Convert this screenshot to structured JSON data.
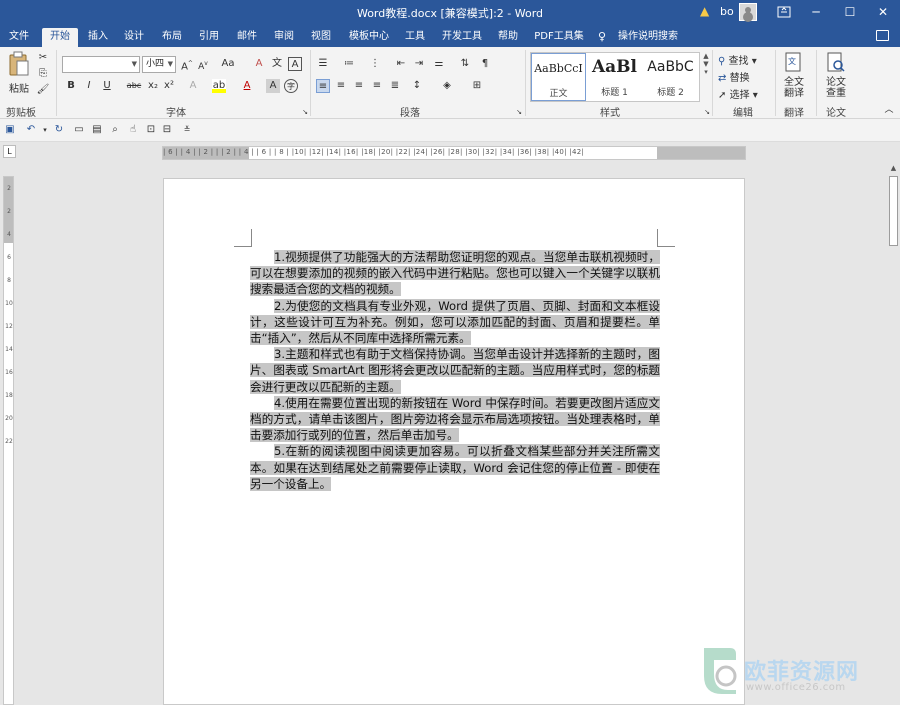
{
  "window": {
    "title": "Word教程.docx [兼容模式]:2  -  Word",
    "user": "bo",
    "minimize": "─",
    "restore": "☐",
    "close": "✕"
  },
  "tabs": [
    "文件",
    "开始",
    "插入",
    "设计",
    "布局",
    "引用",
    "邮件",
    "审阅",
    "视图",
    "模板中心",
    "工具",
    "开发工具",
    "帮助",
    "PDF工具集"
  ],
  "active_tab": "开始",
  "tell_me": "操作说明搜索",
  "ribbon": {
    "clipboard": {
      "paste": "粘贴",
      "label": "剪贴板"
    },
    "font": {
      "name": "",
      "size": "小四",
      "label": "字体",
      "bold": "B",
      "italic": "I",
      "underline": "U",
      "strike": "abc",
      "sub": "x₂",
      "sup": "x²",
      "grow": "A",
      "shrink": "A",
      "case": "Aa",
      "clear": "A",
      "phonetic": "文",
      "border": "A",
      "effect": "A",
      "highlight": "ab",
      "color": "A",
      "charshade": "A",
      "enclose": "字"
    },
    "paragraph": {
      "label": "段落"
    },
    "styles": {
      "label": "样式",
      "items": [
        {
          "sample": "AaBbCcI",
          "name": "正文"
        },
        {
          "sample": "AaBl",
          "name": "标题 1"
        },
        {
          "sample": "AaBbC",
          "name": "标题 2"
        }
      ]
    },
    "editing": {
      "find": "查找",
      "replace": "替换",
      "select": "选择",
      "label": "编辑"
    },
    "translate": {
      "btn": "全文\n翻译",
      "label": "翻译"
    },
    "paper": {
      "btn": "论文\n查重",
      "label": "论文"
    }
  },
  "ruler": {
    "h_ticks": "| 6 |   | 4 |   | 2 |   |      | 2 |   | 4 |   | 6 |   | 8 |   |10|  |12|  |14|  |16|  |18|  |20|  |22|  |24|  |26|  |28|  |30|  |32|  |34|  |36|  |38|  |40|  |42|",
    "v_ticks": [
      "2",
      "",
      "2",
      "4",
      "6",
      "8",
      "10",
      "12",
      "14",
      "16",
      "18",
      "20",
      "22"
    ],
    "tab_selector": "L"
  },
  "document": {
    "paragraphs": [
      "1.视频提供了功能强大的方法帮助您证明您的观点。当您单击联机视频时，可以在想要添加的视频的嵌入代码中进行粘贴。您也可以键入一个关键字以联机搜索最适合您的文档的视频。",
      "2.为使您的文档具有专业外观，Word 提供了页眉、页脚、封面和文本框设计，这些设计可互为补充。例如，您可以添加匹配的封面、页眉和提要栏。单击“插入”，然后从不同库中选择所需元素。",
      "3.主题和样式也有助于文档保持协调。当您单击设计并选择新的主题时，图片、图表或 SmartArt 图形将会更改以匹配新的主题。当应用样式时，您的标题会进行更改以匹配新的主题。",
      "4.使用在需要位置出现的新按钮在 Word 中保存时间。若要更改图片适应文档的方式，请单击该图片，图片旁边将会显示布局选项按钮。当处理表格时，单击要添加行或列的位置，然后单击加号。",
      "5.在新的阅读视图中阅读更加容易。可以折叠文档某些部分并关注所需文本。如果在达到结尾处之前需要停止读取，Word 会记住您的停止位置 - 即使在另一个设备上。"
    ]
  },
  "watermark": {
    "name": "欧菲资源网",
    "url": "www.office26.com"
  },
  "colors": {
    "word_blue": "#2b579a",
    "highlight_gray": "#c6c6c6"
  }
}
